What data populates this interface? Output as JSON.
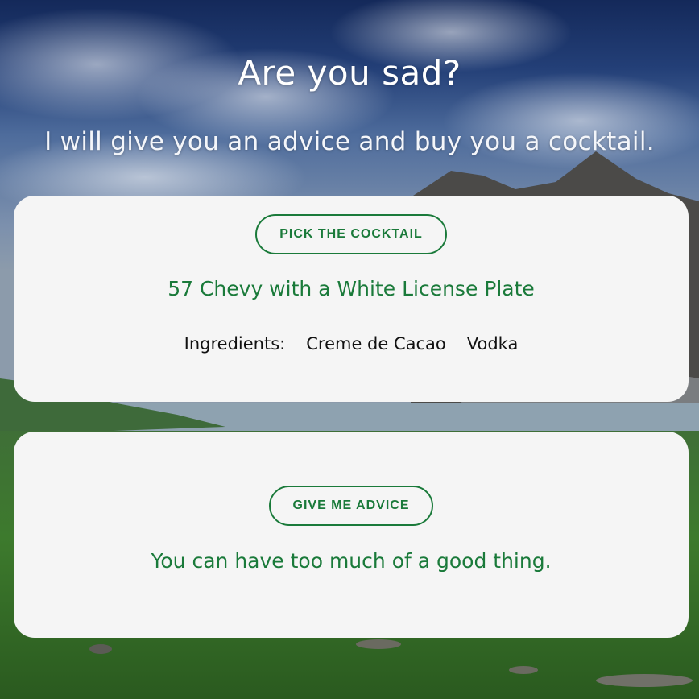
{
  "header": {
    "title": "Are you sad?",
    "subtitle": "I will give you an advice and buy you a cocktail."
  },
  "cocktail": {
    "button_label": "PICK THE COCKTAIL",
    "name": "57 Chevy with a White License Plate",
    "ingredients_label": "Ingredients:",
    "ingredients": [
      "Creme de Cacao",
      "Vodka"
    ]
  },
  "advice": {
    "button_label": "GIVE ME ADVICE",
    "text": "You can have too much of a good thing."
  },
  "colors": {
    "accent": "#1a7a3a",
    "card_background": "#f5f5f5",
    "header_text": "#ffffff"
  },
  "background": {
    "scene": "landscape-photo"
  }
}
